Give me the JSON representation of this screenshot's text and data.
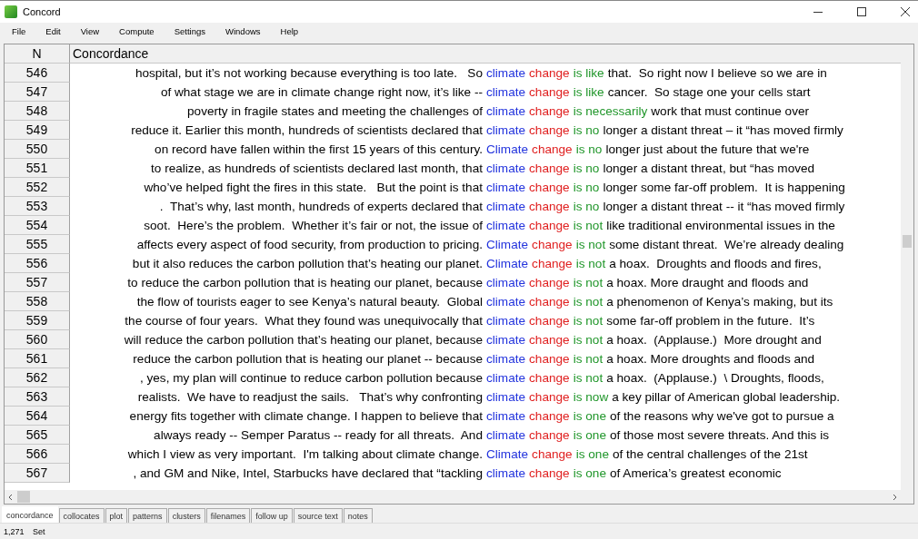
{
  "window": {
    "title": "Concord"
  },
  "menu": [
    "File",
    "Edit",
    "View",
    "Compute",
    "Settings",
    "Windows",
    "Help"
  ],
  "table": {
    "columns": [
      "N",
      "Concordance"
    ],
    "rows": [
      {
        "n": "546",
        "left": "hospital, but it’s not working because everything is too late.   So",
        "node": "climate",
        "search": "change",
        "collocate": "is like",
        "right": "that.  So right now I believe so we are in"
      },
      {
        "n": "547",
        "left": "of what stage we are in climate change right now, it’s like --",
        "node": "climate",
        "search": "change",
        "collocate": "is like",
        "right": "cancer.  So stage one your cells start"
      },
      {
        "n": "548",
        "left": "poverty in fragile states and meeting the challenges of",
        "node": "climate",
        "search": "change",
        "collocate": "is necessarily",
        "right": "work that must continue over"
      },
      {
        "n": "549",
        "left": "reduce it. Earlier this month, hundreds of scientists declared that",
        "node": "climate",
        "search": "change",
        "collocate": "is no",
        "right": "longer a distant threat – it “has moved firmly"
      },
      {
        "n": "550",
        "left": "on record have fallen within the first 15 years of this century.",
        "node": "Climate",
        "search": "change",
        "collocate": "is no",
        "right": "longer just about the future that we're"
      },
      {
        "n": "551",
        "left": "to realize, as hundreds of scientists declared last month, that",
        "node": "climate",
        "search": "change",
        "collocate": "is no",
        "right": "longer a distant threat, but “has moved"
      },
      {
        "n": "552",
        "left": "who’ve helped fight the fires in this state.   But the point is that",
        "node": "climate",
        "search": "change",
        "collocate": "is no",
        "right": "longer some far-off problem.  It is happening"
      },
      {
        "n": "553",
        "left": ".  That’s why, last month, hundreds of experts declared that",
        "node": "climate",
        "search": "change",
        "collocate": "is no",
        "right": "longer a distant threat -- it “has moved firmly"
      },
      {
        "n": "554",
        "left": "soot.  Here’s the problem.  Whether it’s fair or not, the issue of",
        "node": "climate",
        "search": "change",
        "collocate": "is not",
        "right": "like traditional environmental issues in the"
      },
      {
        "n": "555",
        "left": "affects every aspect of food security, from production to pricing.",
        "node": "Climate",
        "search": "change",
        "collocate": "is not",
        "right": "some distant threat.  We’re already dealing"
      },
      {
        "n": "556",
        "left": "but it also reduces the carbon pollution that’s heating our planet.",
        "node": "Climate",
        "search": "change",
        "collocate": "is not",
        "right": "a hoax.  Droughts and floods and fires,"
      },
      {
        "n": "557",
        "left": "to reduce the carbon pollution that is heating our planet, because",
        "node": "climate",
        "search": "change",
        "collocate": "is not",
        "right": "a hoax. More draught and floods and"
      },
      {
        "n": "558",
        "left": "the flow of tourists eager to see Kenya’s natural beauty.  Global",
        "node": "climate",
        "search": "change",
        "collocate": "is not",
        "right": "a phenomenon of Kenya’s making, but its"
      },
      {
        "n": "559",
        "left": "the course of four years.  What they found was unequivocally that",
        "node": "climate",
        "search": "change",
        "collocate": "is not",
        "right": "some far-off problem in the future.  It’s"
      },
      {
        "n": "560",
        "left": "will reduce the carbon pollution that’s heating our planet, because",
        "node": "climate",
        "search": "change",
        "collocate": "is not",
        "right": "a hoax.  (Applause.)  More drought and"
      },
      {
        "n": "561",
        "left": "reduce the carbon pollution that is heating our planet -- because",
        "node": "climate",
        "search": "change",
        "collocate": "is not",
        "right": "a hoax. More droughts and floods and"
      },
      {
        "n": "562",
        "left": ", yes, my plan will continue to reduce carbon pollution because",
        "node": "climate",
        "search": "change",
        "collocate": "is not",
        "right": "a hoax.  (Applause.)  \\ Droughts, floods,"
      },
      {
        "n": "563",
        "left": "realists.  We have to readjust the sails.   That’s why confronting",
        "node": "climate",
        "search": "change",
        "collocate": "is now",
        "right": "a key pillar of American global leadership."
      },
      {
        "n": "564",
        "left": "energy fits together with climate change. I happen to believe that",
        "node": "climate",
        "search": "change",
        "collocate": "is one",
        "right": "of the reasons why we've got to pursue a"
      },
      {
        "n": "565",
        "left": "always ready -- Semper Paratus -- ready for all threats.  And",
        "node": "climate",
        "search": "change",
        "collocate": "is one",
        "right": "of those most severe threats. And this is"
      },
      {
        "n": "566",
        "left": "which I view as very important.  I'm talking about climate change.",
        "node": "Climate",
        "search": "change",
        "collocate": "is one",
        "right": "of the central challenges of the 21st"
      },
      {
        "n": "567",
        "left": ", and GM and Nike, Intel, Starbucks have declared that “tackling",
        "node": "climate",
        "search": "change",
        "collocate": "is one",
        "right": "of America’s greatest economic"
      }
    ]
  },
  "tabs": [
    {
      "label": "concordance",
      "selected": true
    },
    {
      "label": "collocates",
      "selected": false
    },
    {
      "label": "plot",
      "selected": false
    },
    {
      "label": "patterns",
      "selected": false
    },
    {
      "label": "clusters",
      "selected": false
    },
    {
      "label": "filenames",
      "selected": false
    },
    {
      "label": "follow up",
      "selected": false
    },
    {
      "label": "source text",
      "selected": false
    },
    {
      "label": "notes",
      "selected": false
    }
  ],
  "status_bar": [
    "1,271",
    "Set"
  ]
}
